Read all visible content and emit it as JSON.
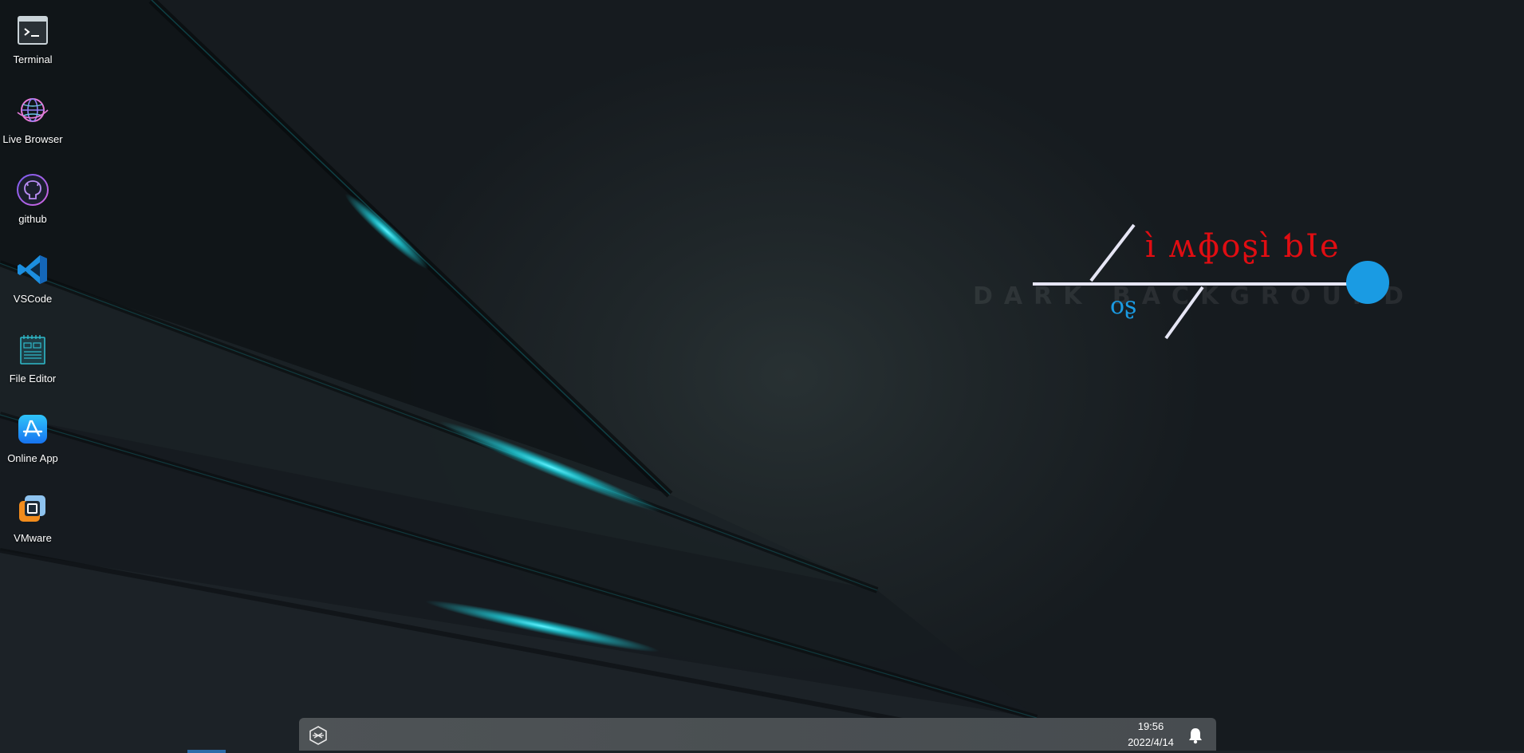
{
  "desktop": {
    "icons": [
      {
        "label": "Terminal",
        "icon": "terminal-icon"
      },
      {
        "label": "Live Browser",
        "icon": "globe-icon"
      },
      {
        "label": "github",
        "icon": "github-icon"
      },
      {
        "label": "VSCode",
        "icon": "vscode-icon"
      },
      {
        "label": "File Editor",
        "icon": "notepad-icon"
      },
      {
        "label": "Online App",
        "icon": "app-store-icon"
      },
      {
        "label": "VMware",
        "icon": "vmware-icon"
      }
    ]
  },
  "logo": {
    "main_text": "ì ʍɸοʂì ƅƖe",
    "sub_text": "οʂ",
    "watermark": "DARK BACKGROUND",
    "colors": {
      "main": "#e00d12",
      "sub": "#1a9be3",
      "lines": "#e6e6f5"
    }
  },
  "taskbar": {
    "start_icon": "hexagon-logo-icon",
    "time": "19:56",
    "date": "2022/4/14",
    "notification_icon": "bell-icon"
  },
  "theme": {
    "accent_glow": "#1fd3e0",
    "taskbar_bg": "#4c5154"
  }
}
